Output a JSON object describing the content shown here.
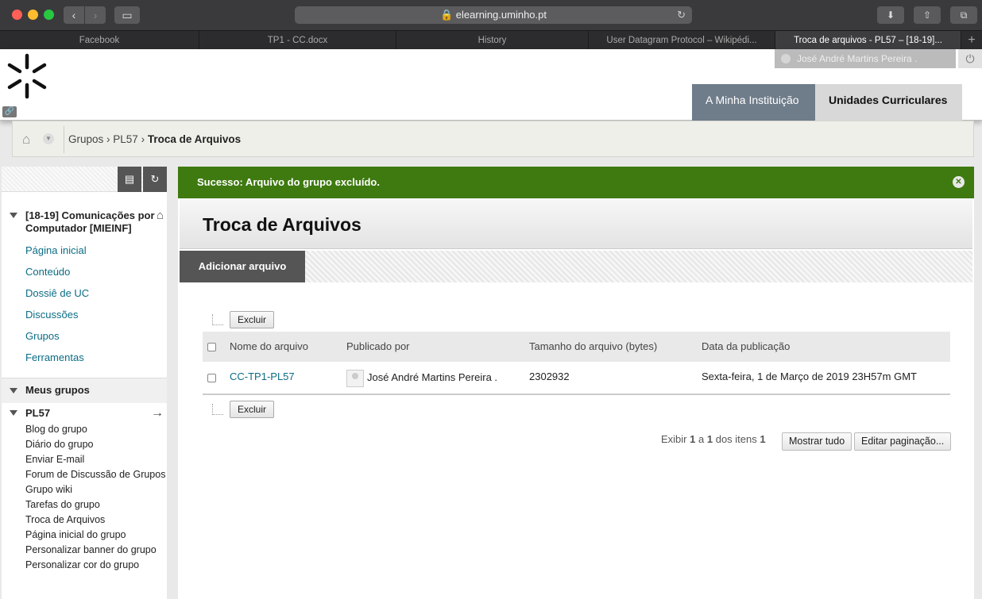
{
  "browser": {
    "url": "elearning.uminho.pt",
    "tabs": [
      "Facebook",
      "TP1 - CC.docx",
      "History",
      "User Datagram Protocol – Wikipédi...",
      "Troca de arquivos - PL57 – [18-19]..."
    ]
  },
  "header": {
    "user_name": "José André Martins Pereira .",
    "nav": [
      "A Minha Instituição",
      "Unidades Curriculares"
    ]
  },
  "breadcrumb": {
    "items": [
      "Grupos",
      "PL57"
    ],
    "current": "Troca de Arquivos"
  },
  "sidebar": {
    "course_title": "[18-19] Comunicações por Computador [MIEINF]",
    "menu": [
      "Página inicial",
      "Conteúdo",
      "Dossiê de UC",
      "Discussões",
      "Grupos",
      "Ferramentas"
    ],
    "groups_header": "Meus grupos",
    "group_name": "PL57",
    "group_links": [
      "Blog do grupo",
      "Diário do grupo",
      "Enviar E-mail",
      "Forum de Discussão de Grupos",
      "Grupo wiki",
      "Tarefas do grupo",
      "Troca de Arquivos",
      "Página inicial do grupo",
      "Personalizar banner do grupo",
      "Personalizar cor do grupo"
    ]
  },
  "main": {
    "success_msg": "Sucesso: Arquivo do grupo excluído.",
    "page_title": "Troca de Arquivos",
    "add_file": "Adicionar arquivo",
    "delete_label": "Excluir",
    "columns": [
      "Nome do arquivo",
      "Publicado por",
      "Tamanho do arquivo (bytes)",
      "Data da publicação"
    ],
    "rows": [
      {
        "name": "CC-TP1-PL57",
        "author": "José André Martins Pereira .",
        "size": "2302932",
        "date": "Sexta-feira, 1 de Março de 2019 23H57m GMT"
      }
    ],
    "pager": {
      "prefix": "Exibir",
      "from": "1",
      "sep": "a",
      "to": "1",
      "of": "dos itens",
      "total": "1"
    },
    "show_all": "Mostrar tudo",
    "edit_paging": "Editar paginação..."
  },
  "icons": [
    "reload-icon",
    "download-icon",
    "share-icon",
    "tabs-icon",
    "power-icon",
    "home-icon",
    "folder-icon",
    "refresh-icon"
  ]
}
